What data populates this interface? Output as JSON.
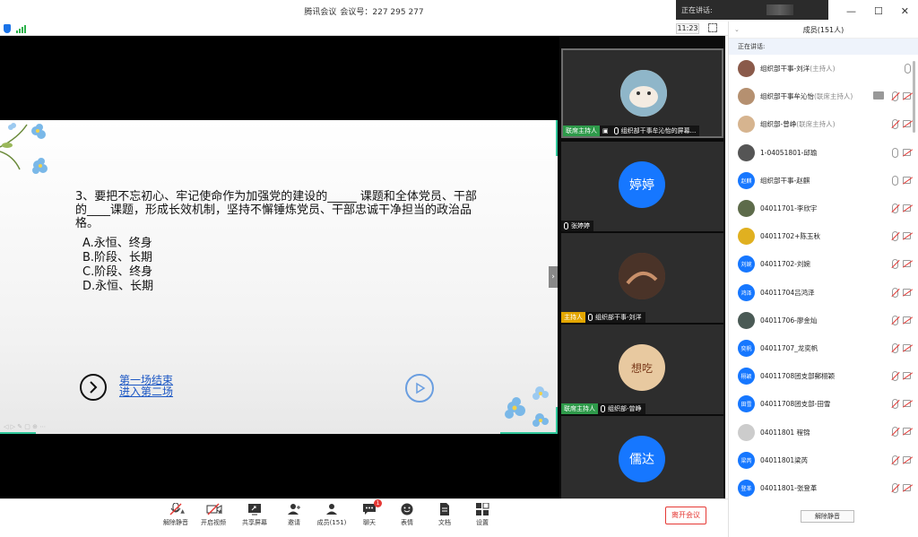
{
  "titlebar": {
    "app_name": "腾讯会议",
    "meeting_label": "会议号：227 295 277"
  },
  "speaking_tip": "正在讲话:",
  "window_controls": {
    "minimize": "—",
    "maximize": "☐",
    "close": "✕"
  },
  "infostrip": {
    "time": "11:23"
  },
  "slide": {
    "question": "3、要把不忘初心、牢记使命作为加强党的建设的_____ 课题和全体党员、干部的____课题，形成长效机制，坚持不懈锤炼党员、干部忠诚干净担当的政治品格。",
    "options": [
      "A.永恒、终身",
      "B.阶段、长期",
      "C.阶段、终身",
      "D.永恒、长期"
    ],
    "link1": "第一场结束",
    "link2": "进入第二场",
    "collapse": "›"
  },
  "video_tiles": [
    {
      "badge": "联席主持人",
      "name": "组织部干事牟沁怡的屏幕...",
      "avatar_text": "",
      "avatar_color": "#c9a98a"
    },
    {
      "badge": "",
      "name": "张婷婷",
      "avatar_text": "婷婷",
      "avatar_color": "#1677ff"
    },
    {
      "badge": "主持人",
      "name": "组织部干事-刘洋",
      "avatar_text": "",
      "avatar_color": "#6b4a3a"
    },
    {
      "badge": "联席主持人",
      "name": "组织部-曾峥",
      "avatar_text": "想吃",
      "avatar_color": "#e8c9a0"
    },
    {
      "badge": "",
      "name": "",
      "avatar_text": "儒达",
      "avatar_color": "#1677ff"
    }
  ],
  "toolbar": {
    "unmute": "解除静音",
    "video": "开启视频",
    "share": "共享屏幕",
    "invite": "邀请",
    "members": "成员(151)",
    "chat": "聊天",
    "chat_badge": "1",
    "emoji": "表情",
    "docs": "文档",
    "settings": "设置",
    "leave": "离开会议"
  },
  "panel": {
    "title": "成员(151人)",
    "speaking": "正在讲话:",
    "unmute_all": "解除静音",
    "members": [
      {
        "name": "组织部干事-刘洋",
        "role": "(主持人)",
        "avatar_text": "",
        "color": "#8a5a4a",
        "mic": "on",
        "cam": "none",
        "share": false
      },
      {
        "name": "组织部干事牟沁怡",
        "role": "(联席主持人)",
        "avatar_text": "",
        "color": "#b59070",
        "mic": "muted",
        "cam": "off",
        "share": true
      },
      {
        "name": "组织部-曾峥",
        "role": "(联席主持人)",
        "avatar_text": "",
        "color": "#d6b48f",
        "mic": "muted",
        "cam": "off",
        "share": false
      },
      {
        "name": "1-04051801-邱瑜",
        "role": "",
        "avatar_text": "",
        "color": "#555",
        "mic": "on",
        "cam": "off",
        "share": false
      },
      {
        "name": "组织部干事-赵麒",
        "role": "",
        "avatar_text": "赵麒",
        "color": "#1677ff",
        "mic": "on",
        "cam": "off",
        "share": false
      },
      {
        "name": "04011701-李欣宇",
        "role": "",
        "avatar_text": "",
        "color": "#5d6b4a",
        "mic": "muted",
        "cam": "off",
        "share": false
      },
      {
        "name": "04011702+陈玉秋",
        "role": "",
        "avatar_text": "",
        "color": "#e0b020",
        "mic": "muted",
        "cam": "off",
        "share": false
      },
      {
        "name": "04011702-刘婉",
        "role": "",
        "avatar_text": "刘婉",
        "color": "#1677ff",
        "mic": "muted",
        "cam": "off",
        "share": false
      },
      {
        "name": "04011704吕鸿泽",
        "role": "",
        "avatar_text": "鸿泽",
        "color": "#1677ff",
        "mic": "muted",
        "cam": "off",
        "share": false
      },
      {
        "name": "04011706-廖金灿",
        "role": "",
        "avatar_text": "",
        "color": "#4a5a55",
        "mic": "muted",
        "cam": "off",
        "share": false
      },
      {
        "name": "04011707_龙奕帆",
        "role": "",
        "avatar_text": "奕帆",
        "color": "#1677ff",
        "mic": "muted",
        "cam": "off",
        "share": false
      },
      {
        "name": "04011708团支部郵栩颖",
        "role": "",
        "avatar_text": "栩颖",
        "color": "#1677ff",
        "mic": "muted",
        "cam": "off",
        "share": false
      },
      {
        "name": "04011708团支部-田雪",
        "role": "",
        "avatar_text": "田雪",
        "color": "#1677ff",
        "mic": "muted",
        "cam": "off",
        "share": false
      },
      {
        "name": "04011801 程锦",
        "role": "",
        "avatar_text": "",
        "color": "#cccccc",
        "mic": "muted",
        "cam": "off",
        "share": false
      },
      {
        "name": "04011801梁芮",
        "role": "",
        "avatar_text": "梁芮",
        "color": "#1677ff",
        "mic": "muted",
        "cam": "off",
        "share": false
      },
      {
        "name": "04011801-张登革",
        "role": "",
        "avatar_text": "登革",
        "color": "#1677ff",
        "mic": "muted",
        "cam": "off",
        "share": false
      }
    ]
  }
}
